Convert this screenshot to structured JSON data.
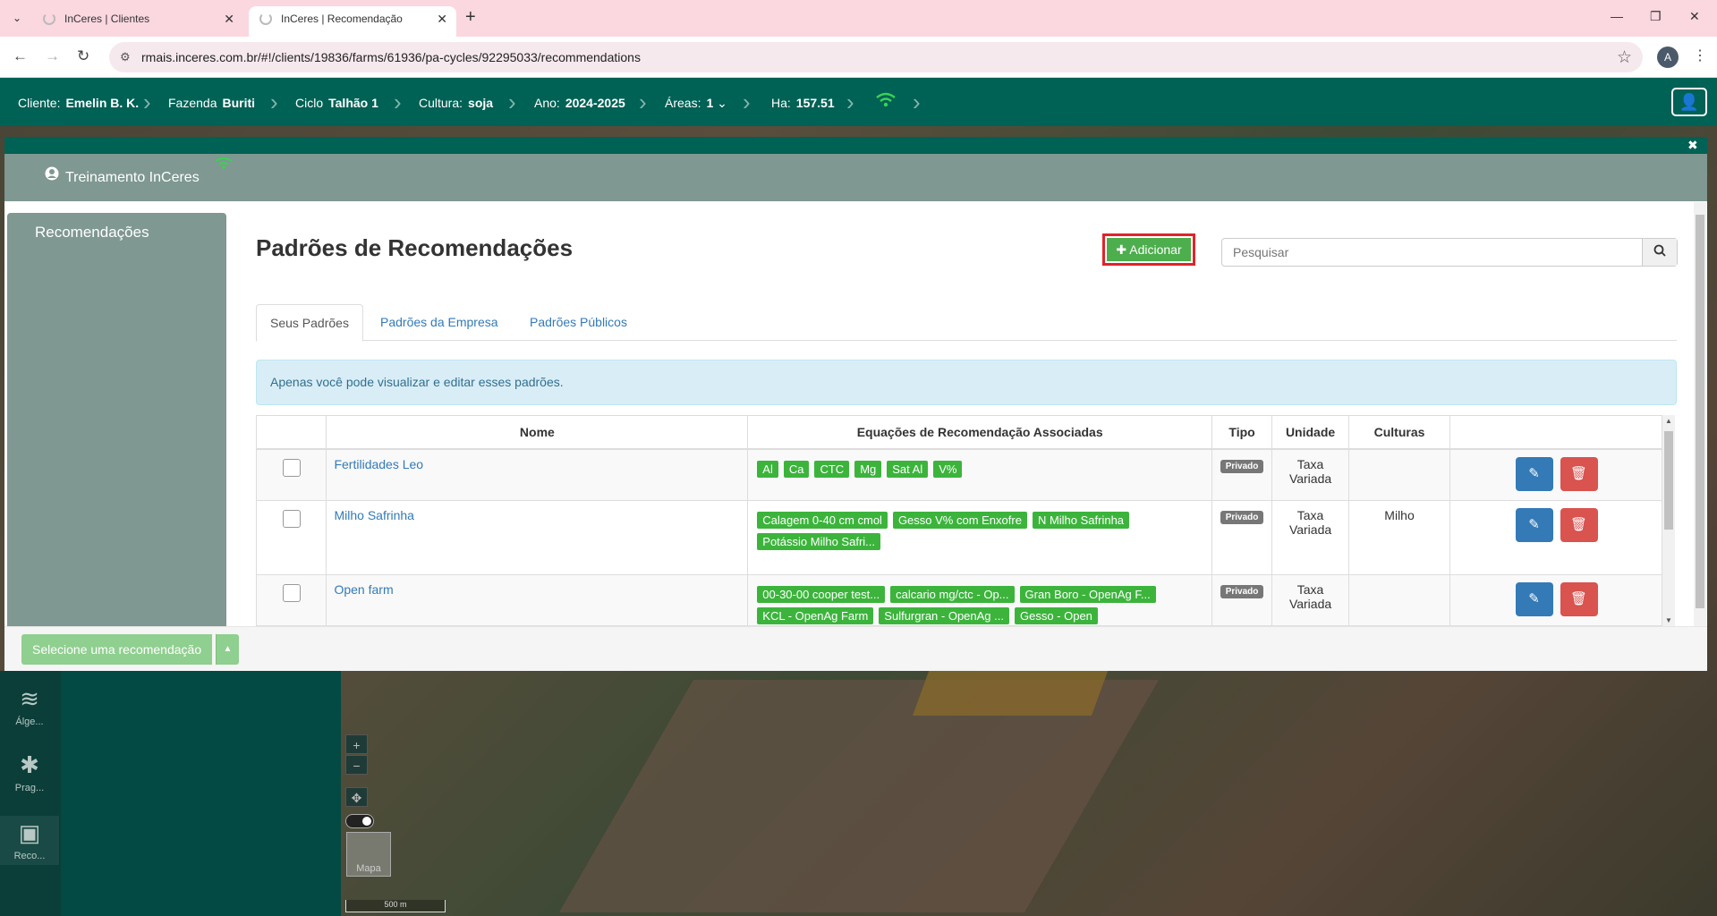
{
  "browser": {
    "tabs": [
      {
        "title": "InCeres | Clientes"
      },
      {
        "title": "InCeres | Recomendação"
      }
    ],
    "url": "rmais.inceres.com.br/#!/clients/19836/farms/61936/pa-cycles/92295033/recommendations",
    "profile_initial": "A"
  },
  "appbar": {
    "cliente_label": "Cliente:",
    "cliente_value": "Emelin B. K.",
    "fazenda_label": "Fazenda",
    "fazenda_value": "Buriti",
    "ciclo_label": "Ciclo",
    "ciclo_value": "Talhão 1",
    "cultura_label": "Cultura:",
    "cultura_value": "soja",
    "ano_label": "Ano:",
    "ano_value": "2024-2025",
    "areas_label": "Áreas:",
    "areas_value": "1",
    "ha_label": "Ha:",
    "ha_value": "157.51"
  },
  "modal": {
    "user_name": "Treinamento InCeres",
    "sidebar_item": "Recomendações",
    "title": "Padrões de Recomendações",
    "add_label": "Adicionar",
    "search_placeholder": "Pesquisar",
    "tabs": [
      {
        "label": "Seus Padrões",
        "active": true
      },
      {
        "label": "Padrões da Empresa",
        "active": false
      },
      {
        "label": "Padrões Públicos",
        "active": false
      }
    ],
    "alert": "Apenas você pode visualizar e editar esses padrões.",
    "columns": [
      "Nome",
      "Equações de Recomendação Associadas",
      "Tipo",
      "Unidade",
      "Culturas"
    ],
    "rows": [
      {
        "nome": "Fertilidades Leo",
        "equacoes": [
          "Al",
          "Ca",
          "CTC",
          "Mg",
          "Sat Al",
          "V%"
        ],
        "tipo": "Privado",
        "unidade_1": "Taxa",
        "unidade_2": "Variada",
        "culturas": ""
      },
      {
        "nome": "Milho Safrinha",
        "equacoes": [
          "Calagem 0-40 cm cmol",
          "Gesso V% com Enxofre",
          "N Milho Safrinha",
          "Potássio Milho Safri..."
        ],
        "tipo": "Privado",
        "unidade_1": "Taxa",
        "unidade_2": "Variada",
        "culturas": "Milho"
      },
      {
        "nome": "Open farm",
        "equacoes": [
          "00-30-00 cooper test...",
          "calcario mg/ctc - Op...",
          "Gran Boro - OpenAg F...",
          "KCL - OpenAg Farm",
          "Sulfurgran - OpenAg ...",
          "Gesso - Open"
        ],
        "tipo": "Privado",
        "unidade_1": "Taxa",
        "unidade_2": "Variada",
        "culturas": ""
      }
    ],
    "footer_select": "Selecione uma recomendação"
  },
  "map": {
    "side_items": [
      {
        "label": "Álge...",
        "icon": "layers-icon"
      },
      {
        "label": "Prag...",
        "icon": "bug-icon"
      },
      {
        "label": "Reco...",
        "icon": "fertilizer-icon"
      }
    ],
    "thumb_label": "Mapa",
    "scale_label": "500 m"
  },
  "colors": {
    "brand_green": "#006155",
    "add_green": "#4cae4c",
    "highlight_red": "#e0242a",
    "tag_green": "#3cb43c"
  }
}
